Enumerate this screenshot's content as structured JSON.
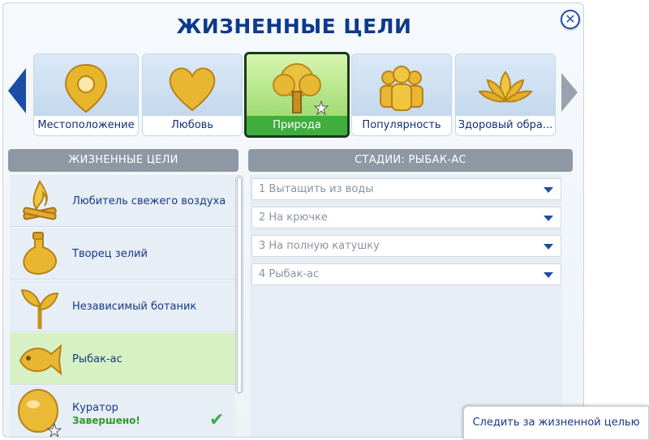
{
  "title": "ЖИЗНЕННЫЕ ЦЕЛИ",
  "close_symbol": "✕",
  "categories": [
    {
      "label": "Местоположение",
      "icon": "location-pin-icon"
    },
    {
      "label": "Любовь",
      "icon": "heart-icon"
    },
    {
      "label": "Природа",
      "icon": "tree-icon",
      "active": true
    },
    {
      "label": "Популярность",
      "icon": "people-group-icon"
    },
    {
      "label": "Здоровый обра...",
      "icon": "lotus-icon"
    }
  ],
  "left_panel": {
    "header": "ЖИЗНЕННЫЕ ЦЕЛИ"
  },
  "goals": [
    {
      "name": "Любитель свежего воздуха",
      "icon": "campfire-icon"
    },
    {
      "name": "Творец зелий",
      "icon": "potion-flask-icon"
    },
    {
      "name": "Независимый ботаник",
      "icon": "sprout-icon"
    },
    {
      "name": "Рыбак-ас",
      "icon": "fish-icon",
      "selected": true
    },
    {
      "name": "Куратор",
      "status": "Завершено!",
      "icon": "gem-icon",
      "check": "✔"
    }
  ],
  "right_panel": {
    "header": "СТАДИИ: РЫБАК-АС"
  },
  "stages": [
    "1 Вытащить из воды",
    "2 На крючке",
    "3 На полную катушку",
    "4 Рыбак-ас"
  ],
  "track_button": "Следить за жизненной целью",
  "colors": {
    "accent": "#0d3a8c",
    "active": "#3fae3f",
    "done": "#2e9b2e"
  }
}
